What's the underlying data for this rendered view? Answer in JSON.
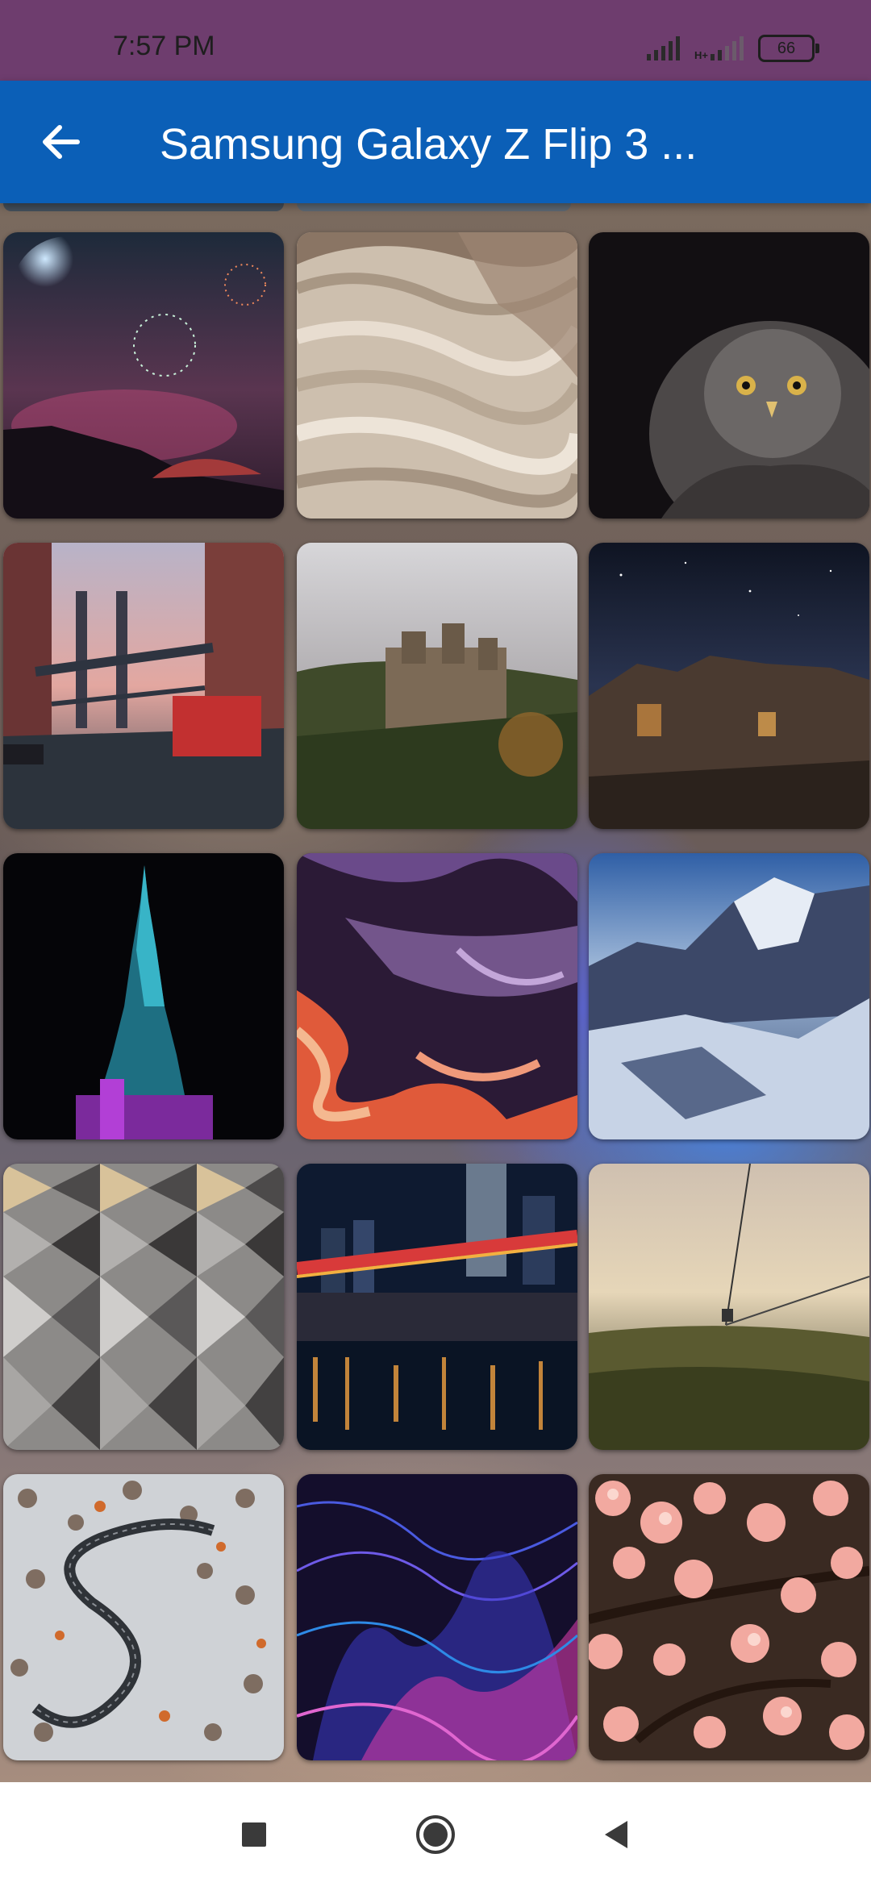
{
  "status_bar": {
    "time": "7:57 PM",
    "network": "H+",
    "battery": "66"
  },
  "app_bar": {
    "title": "Samsung Galaxy Z Flip 3 ..."
  },
  "wallpapers": [
    {
      "name": "fireworks"
    },
    {
      "name": "desert-badlands"
    },
    {
      "name": "owl"
    },
    {
      "name": "manhattan-bridge-street"
    },
    {
      "name": "castle-on-hill"
    },
    {
      "name": "starry-ruins"
    },
    {
      "name": "neon-tower"
    },
    {
      "name": "marbled-paint"
    },
    {
      "name": "snowy-mountains"
    },
    {
      "name": "geodesic-panels"
    },
    {
      "name": "city-bridge-night"
    },
    {
      "name": "foggy-cable-car"
    },
    {
      "name": "winding-road-aerial"
    },
    {
      "name": "neon-wave-lines"
    },
    {
      "name": "pink-blossoms"
    }
  ],
  "navigation": {
    "recents_icon": "square-icon",
    "home_icon": "circle-icon",
    "back_icon": "triangle-back-icon"
  }
}
